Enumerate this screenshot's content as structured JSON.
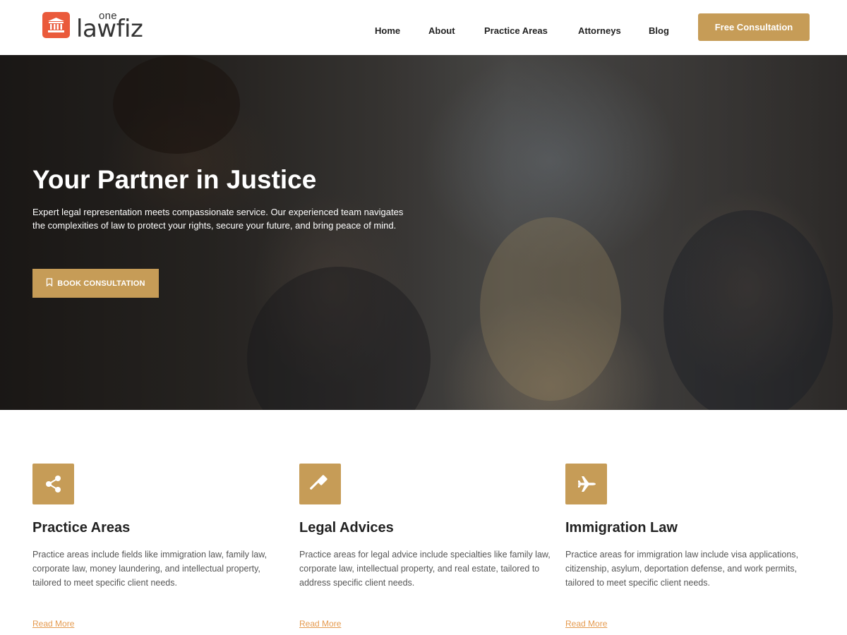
{
  "brand": {
    "logo_small": "one",
    "logo_main": "lawfiz",
    "accent_color": "#c69c57",
    "logo_color": "#ea5a3b"
  },
  "nav": {
    "items": [
      {
        "label": "Home"
      },
      {
        "label": "About"
      },
      {
        "label": "Practice Areas"
      },
      {
        "label": "Attorneys"
      },
      {
        "label": "Blog"
      }
    ],
    "cta_label": "Free Consultation"
  },
  "hero": {
    "title": "Your Partner in Justice",
    "description": "Expert legal representation meets compassionate service. Our experienced team navigates the complexities of law to protect your rights, secure your future, and bring peace of mind.",
    "button_label": "BOOK CONSULTATION",
    "button_icon": "bookmark-icon"
  },
  "cards": [
    {
      "icon": "share-icon",
      "title": "Practice Areas",
      "description": "Practice areas include fields like immigration law, family law, corporate law, money laundering, and intellectual property, tailored to meet specific client needs.",
      "link": "Read More"
    },
    {
      "icon": "gavel-icon",
      "title": "Legal Advices",
      "description": "Practice areas for legal advice include specialties like family law, corporate law, intellectual property, and real estate, tailored to address specific client needs.",
      "link": "Read More"
    },
    {
      "icon": "airplane-icon",
      "title": "Immigration Law",
      "description": "Practice areas for immigration law include visa applications, citizenship, asylum, deportation defense, and work permits, tailored to meet specific client needs.",
      "link": "Read More"
    }
  ]
}
